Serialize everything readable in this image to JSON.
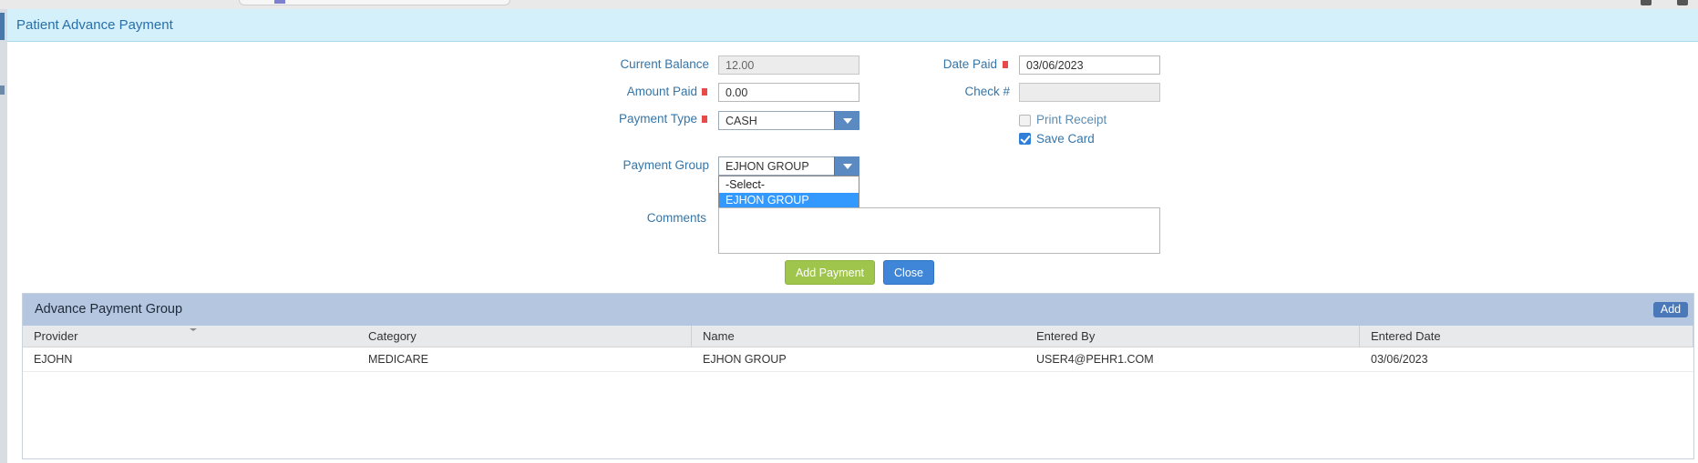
{
  "window": {
    "title": "Patient Advance Payment"
  },
  "form": {
    "current_balance": {
      "label": "Current Balance",
      "value": "12.00"
    },
    "amount_paid": {
      "label": "Amount Paid",
      "value": "0.00"
    },
    "payment_type": {
      "label": "Payment Type",
      "value": "CASH"
    },
    "payment_group": {
      "label": "Payment Group",
      "value": "EJHON GROUP",
      "options": [
        "-Select-",
        "EJHON GROUP"
      ]
    },
    "date_paid": {
      "label": "Date Paid",
      "value": "03/06/2023"
    },
    "check_no": {
      "label": "Check #",
      "value": ""
    },
    "print_receipt": {
      "label": "Print Receipt",
      "checked": false
    },
    "save_card": {
      "label": "Save Card",
      "checked": true
    },
    "comments": {
      "label": "Comments",
      "value": ""
    },
    "add_payment_label": "Add Payment",
    "close_label": "Close"
  },
  "grid": {
    "title": "Advance Payment Group",
    "add_label": "Add",
    "columns": [
      "Provider",
      "Category",
      "Name",
      "Entered By",
      "Entered Date"
    ],
    "rows": [
      [
        "EJOHN",
        "MEDICARE",
        "EJHON GROUP",
        "USER4@PEHR1.COM",
        "03/06/2023"
      ]
    ]
  },
  "colors": {
    "title_bg": "#d3f0fb",
    "accent": "#3575a8",
    "required": "#e84a4a",
    "add_payment": "#9fc54d",
    "close": "#3f86d8",
    "grid_header": "#b4c6e0"
  },
  "icons": [
    "dropdown-arrow-icon",
    "checkbox-icon",
    "required-marker-icon",
    "sort-indicator-icon"
  ]
}
